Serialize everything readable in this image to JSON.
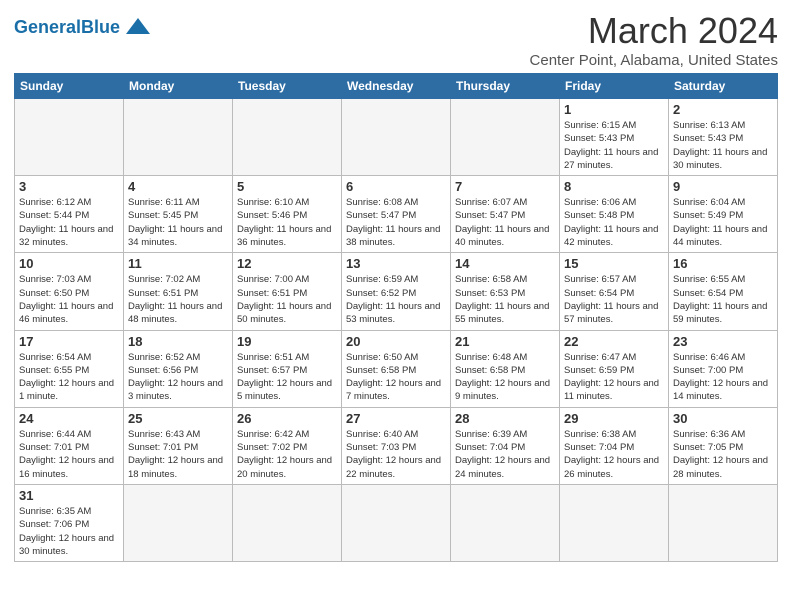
{
  "header": {
    "title": "March 2024",
    "subtitle": "Center Point, Alabama, United States",
    "logo_general": "General",
    "logo_blue": "Blue"
  },
  "days_of_week": [
    "Sunday",
    "Monday",
    "Tuesday",
    "Wednesday",
    "Thursday",
    "Friday",
    "Saturday"
  ],
  "weeks": [
    [
      {
        "day": "",
        "info": ""
      },
      {
        "day": "",
        "info": ""
      },
      {
        "day": "",
        "info": ""
      },
      {
        "day": "",
        "info": ""
      },
      {
        "day": "",
        "info": ""
      },
      {
        "day": "1",
        "info": "Sunrise: 6:15 AM\nSunset: 5:43 PM\nDaylight: 11 hours and 27 minutes."
      },
      {
        "day": "2",
        "info": "Sunrise: 6:13 AM\nSunset: 5:43 PM\nDaylight: 11 hours and 30 minutes."
      }
    ],
    [
      {
        "day": "3",
        "info": "Sunrise: 6:12 AM\nSunset: 5:44 PM\nDaylight: 11 hours and 32 minutes."
      },
      {
        "day": "4",
        "info": "Sunrise: 6:11 AM\nSunset: 5:45 PM\nDaylight: 11 hours and 34 minutes."
      },
      {
        "day": "5",
        "info": "Sunrise: 6:10 AM\nSunset: 5:46 PM\nDaylight: 11 hours and 36 minutes."
      },
      {
        "day": "6",
        "info": "Sunrise: 6:08 AM\nSunset: 5:47 PM\nDaylight: 11 hours and 38 minutes."
      },
      {
        "day": "7",
        "info": "Sunrise: 6:07 AM\nSunset: 5:47 PM\nDaylight: 11 hours and 40 minutes."
      },
      {
        "day": "8",
        "info": "Sunrise: 6:06 AM\nSunset: 5:48 PM\nDaylight: 11 hours and 42 minutes."
      },
      {
        "day": "9",
        "info": "Sunrise: 6:04 AM\nSunset: 5:49 PM\nDaylight: 11 hours and 44 minutes."
      }
    ],
    [
      {
        "day": "10",
        "info": "Sunrise: 7:03 AM\nSunset: 6:50 PM\nDaylight: 11 hours and 46 minutes."
      },
      {
        "day": "11",
        "info": "Sunrise: 7:02 AM\nSunset: 6:51 PM\nDaylight: 11 hours and 48 minutes."
      },
      {
        "day": "12",
        "info": "Sunrise: 7:00 AM\nSunset: 6:51 PM\nDaylight: 11 hours and 50 minutes."
      },
      {
        "day": "13",
        "info": "Sunrise: 6:59 AM\nSunset: 6:52 PM\nDaylight: 11 hours and 53 minutes."
      },
      {
        "day": "14",
        "info": "Sunrise: 6:58 AM\nSunset: 6:53 PM\nDaylight: 11 hours and 55 minutes."
      },
      {
        "day": "15",
        "info": "Sunrise: 6:57 AM\nSunset: 6:54 PM\nDaylight: 11 hours and 57 minutes."
      },
      {
        "day": "16",
        "info": "Sunrise: 6:55 AM\nSunset: 6:54 PM\nDaylight: 11 hours and 59 minutes."
      }
    ],
    [
      {
        "day": "17",
        "info": "Sunrise: 6:54 AM\nSunset: 6:55 PM\nDaylight: 12 hours and 1 minute."
      },
      {
        "day": "18",
        "info": "Sunrise: 6:52 AM\nSunset: 6:56 PM\nDaylight: 12 hours and 3 minutes."
      },
      {
        "day": "19",
        "info": "Sunrise: 6:51 AM\nSunset: 6:57 PM\nDaylight: 12 hours and 5 minutes."
      },
      {
        "day": "20",
        "info": "Sunrise: 6:50 AM\nSunset: 6:58 PM\nDaylight: 12 hours and 7 minutes."
      },
      {
        "day": "21",
        "info": "Sunrise: 6:48 AM\nSunset: 6:58 PM\nDaylight: 12 hours and 9 minutes."
      },
      {
        "day": "22",
        "info": "Sunrise: 6:47 AM\nSunset: 6:59 PM\nDaylight: 12 hours and 11 minutes."
      },
      {
        "day": "23",
        "info": "Sunrise: 6:46 AM\nSunset: 7:00 PM\nDaylight: 12 hours and 14 minutes."
      }
    ],
    [
      {
        "day": "24",
        "info": "Sunrise: 6:44 AM\nSunset: 7:01 PM\nDaylight: 12 hours and 16 minutes."
      },
      {
        "day": "25",
        "info": "Sunrise: 6:43 AM\nSunset: 7:01 PM\nDaylight: 12 hours and 18 minutes."
      },
      {
        "day": "26",
        "info": "Sunrise: 6:42 AM\nSunset: 7:02 PM\nDaylight: 12 hours and 20 minutes."
      },
      {
        "day": "27",
        "info": "Sunrise: 6:40 AM\nSunset: 7:03 PM\nDaylight: 12 hours and 22 minutes."
      },
      {
        "day": "28",
        "info": "Sunrise: 6:39 AM\nSunset: 7:04 PM\nDaylight: 12 hours and 24 minutes."
      },
      {
        "day": "29",
        "info": "Sunrise: 6:38 AM\nSunset: 7:04 PM\nDaylight: 12 hours and 26 minutes."
      },
      {
        "day": "30",
        "info": "Sunrise: 6:36 AM\nSunset: 7:05 PM\nDaylight: 12 hours and 28 minutes."
      }
    ],
    [
      {
        "day": "31",
        "info": "Sunrise: 6:35 AM\nSunset: 7:06 PM\nDaylight: 12 hours and 30 minutes."
      },
      {
        "day": "",
        "info": ""
      },
      {
        "day": "",
        "info": ""
      },
      {
        "day": "",
        "info": ""
      },
      {
        "day": "",
        "info": ""
      },
      {
        "day": "",
        "info": ""
      },
      {
        "day": "",
        "info": ""
      }
    ]
  ]
}
